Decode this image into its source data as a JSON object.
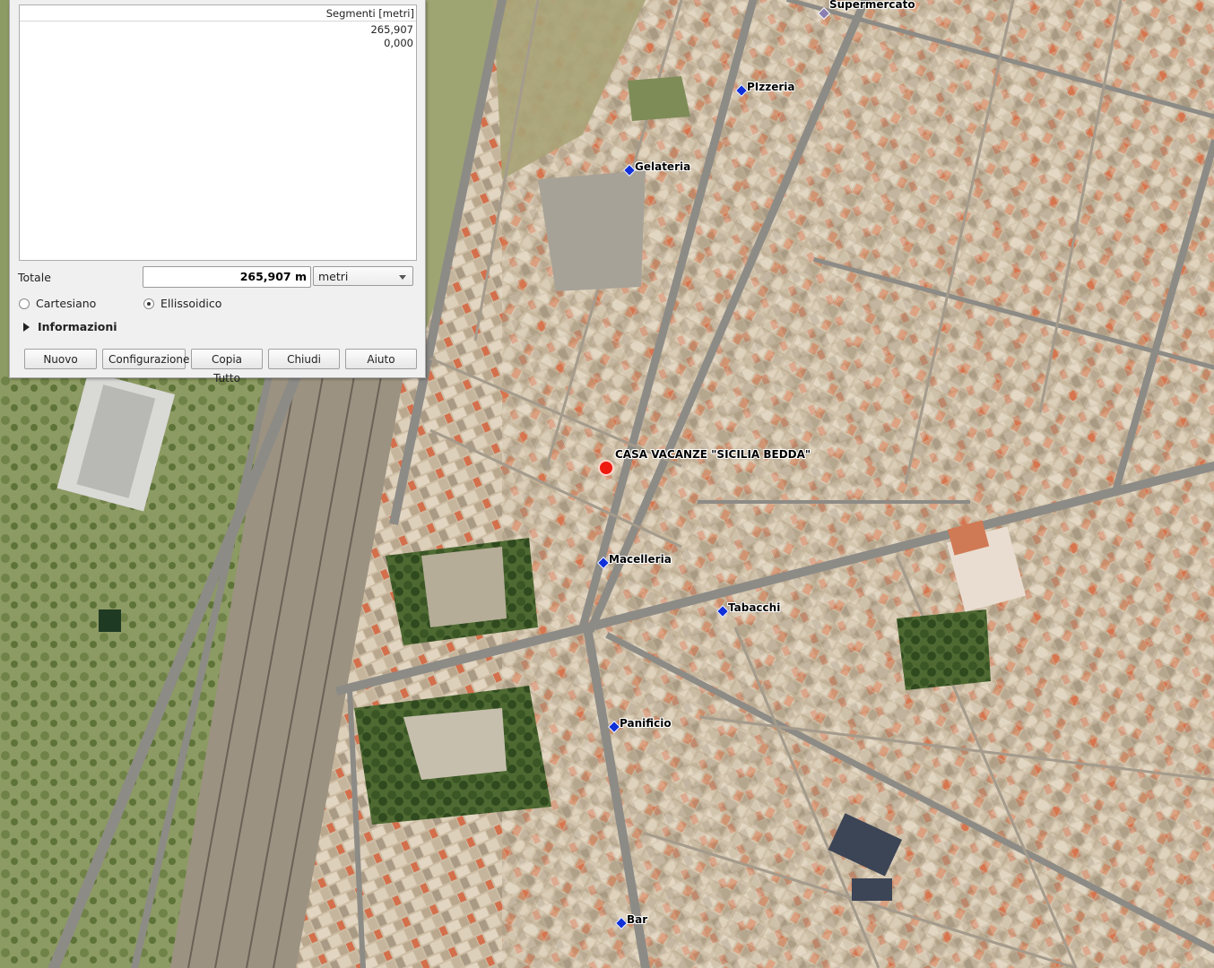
{
  "dialog": {
    "segments_header": "Segmenti [metri]",
    "segments": [
      "265,907",
      "0,000"
    ],
    "total_label": "Totale",
    "total_value": "265,907 m",
    "unit_selected": "metri",
    "radio_cartesiano": "Cartesiano",
    "radio_ellissoidico": "Ellissoidico",
    "selected_mode": "Ellissoidico",
    "info_label": "Informazioni",
    "buttons": {
      "nuovo": "Nuovo",
      "configurazione": "Configurazione",
      "copia_tutto": "Copia Tutto",
      "chiudi": "Chiudi",
      "aiuto": "Aiuto"
    }
  },
  "map": {
    "home_label": "CASA VACANZE \"SICILIA BEDDA\"",
    "pois": [
      {
        "id": "supermercato",
        "label": "Supermercato",
        "icon": "diamond-marker-icon"
      },
      {
        "id": "pizzeria",
        "label": "PIzzeria",
        "icon": "diamond-marker-icon"
      },
      {
        "id": "gelateria",
        "label": "Gelateria",
        "icon": "diamond-marker-icon"
      },
      {
        "id": "macelleria",
        "label": "Macelleria",
        "icon": "diamond-marker-icon"
      },
      {
        "id": "tabacchi",
        "label": "Tabacchi",
        "icon": "diamond-marker-icon"
      },
      {
        "id": "panificio",
        "label": "Panificio",
        "icon": "diamond-marker-icon"
      },
      {
        "id": "bar",
        "label": "Bar",
        "icon": "diamond-marker-icon"
      }
    ],
    "colors": {
      "poi_marker": "#1030d8",
      "home_marker": "#ee1a10"
    }
  }
}
